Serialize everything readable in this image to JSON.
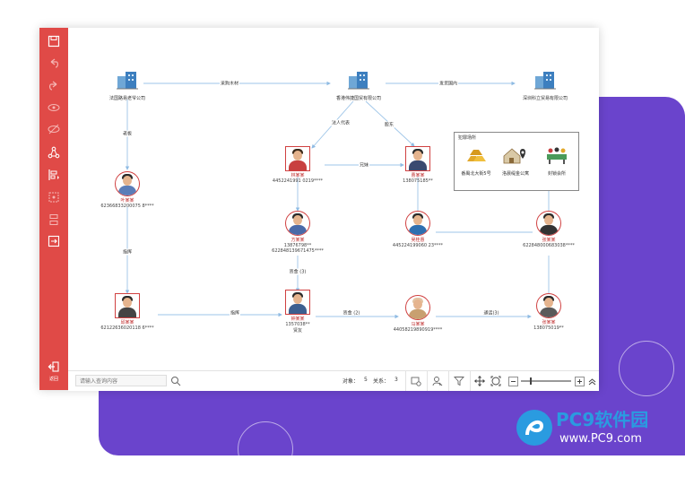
{
  "toolbar": {
    "icons": [
      "save-icon",
      "undo-icon",
      "redo-icon",
      "eye-icon",
      "eye-off-icon",
      "network-icon",
      "layout-icon",
      "grid-icon",
      "split-icon",
      "export-icon"
    ],
    "logout_icon": "logout-icon",
    "logout_label": "返回"
  },
  "graph": {
    "companies": [
      {
        "name": "法国路易老爷公司"
      },
      {
        "name": "香港伟捷国贸有限公司"
      },
      {
        "name": "深圳科立贸易有限公司"
      }
    ],
    "persons": [
      {
        "name": "林某某",
        "id": "4452241991 0219****",
        "note": ""
      },
      {
        "name": "曹某某",
        "id": "138075185**",
        "note": ""
      },
      {
        "name": "叶某某",
        "id": "62366833200075 8****",
        "note": ""
      },
      {
        "name": "方某某",
        "id": "13876798**",
        "id2": "622848139671475****",
        "note": ""
      },
      {
        "name": "吴桂惠",
        "id": "445224199060 23****",
        "note": ""
      },
      {
        "name": "张某某",
        "id": "622848000683038****",
        "note": ""
      },
      {
        "name": "邱某某",
        "id": "62122636020118 6****",
        "note": ""
      },
      {
        "name": "钟某某",
        "id": "1357038**",
        "note": "贤友"
      },
      {
        "name": "马某某",
        "id": "44058219890919****",
        "note": ""
      },
      {
        "name": "张某某",
        "id": "138075019**",
        "note": ""
      }
    ],
    "edges": [
      {
        "label": "采购木材"
      },
      {
        "label": "发货国内"
      },
      {
        "label": "老板"
      },
      {
        "label": "法人代表"
      },
      {
        "label": "股东"
      },
      {
        "label": "兄妹"
      },
      {
        "label": "指挥"
      },
      {
        "label": "指挥"
      },
      {
        "label": "资金 (3)"
      },
      {
        "label": "资金 (2)"
      },
      {
        "label": "通话(3)"
      }
    ],
    "legend": {
      "title": "犯罪场所",
      "items": [
        {
          "label": "番禺北大街5号"
        },
        {
          "label": "洛晨缇金公寓"
        },
        {
          "label": "封锁会所"
        }
      ]
    }
  },
  "bottombar": {
    "search_placeholder": "请输入查询内容",
    "objects_label": "对象：",
    "objects_value": "5",
    "relations_label": "关系：",
    "relations_value": "3",
    "zoom_level": 0.18
  },
  "watermark": {
    "brand": "PC9软件园",
    "url": "www.PC9.com"
  },
  "colors": {
    "toolbar": "#e04a47",
    "accent_purple": "#6a44cc",
    "edge": "#9ec5e8",
    "name_red": "#c03030"
  }
}
